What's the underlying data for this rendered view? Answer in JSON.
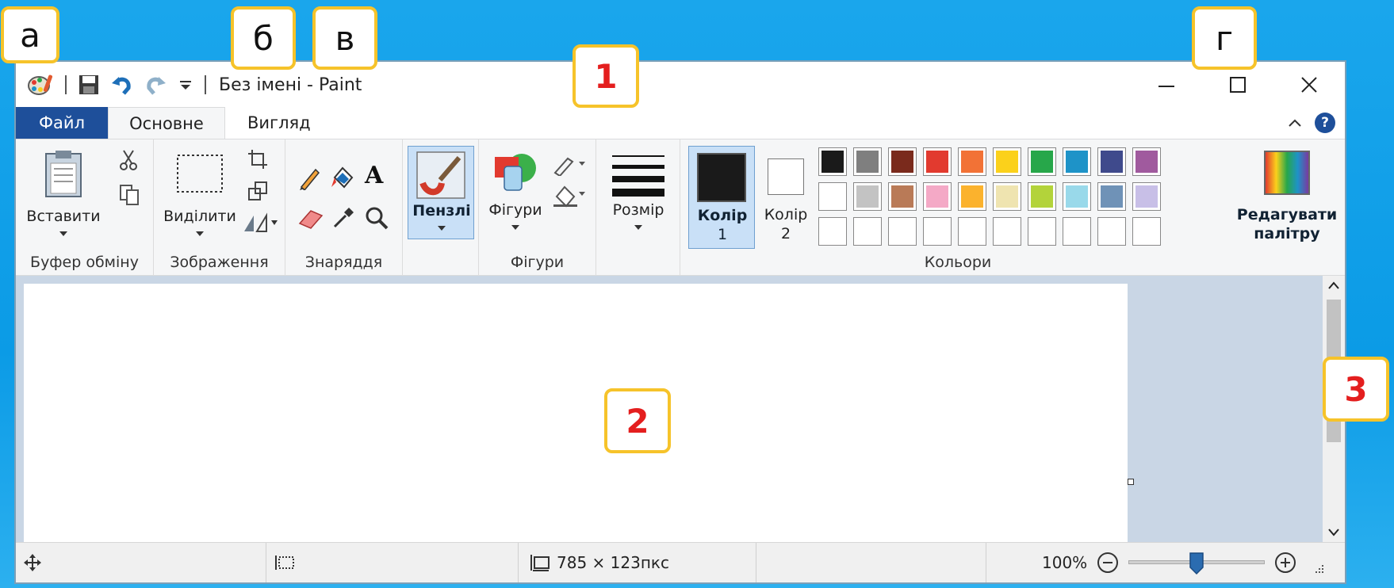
{
  "overlay_labels": {
    "a": "а",
    "b": "б",
    "v": "в",
    "g": "г",
    "n1": "1",
    "n2": "2",
    "n3": "3"
  },
  "window": {
    "title": "Без імені - Paint"
  },
  "tabs": {
    "file": "Файл",
    "home": "Основне",
    "view": "Вигляд"
  },
  "ribbon": {
    "clipboard": {
      "paste": "Вставити",
      "group": "Буфер обміну"
    },
    "image": {
      "select": "Виділити",
      "group": "Зображення"
    },
    "tools": {
      "group": "Знаряддя"
    },
    "brushes": {
      "label": "Пензлі"
    },
    "shapes": {
      "label": "Фігури",
      "group": "Фігури"
    },
    "size": {
      "label": "Розмір"
    },
    "colors": {
      "color1_line1": "Колір",
      "color1_line2": "1",
      "color2_line1": "Колір",
      "color2_line2": "2",
      "edit_line1": "Редагувати",
      "edit_line2": "палітру",
      "group": "Кольори",
      "row1": [
        "#1a1a1a",
        "#7f7f7f",
        "#7a2a1c",
        "#e23a2f",
        "#f27236",
        "#fbd11b",
        "#27a74a",
        "#1e93c8",
        "#3f4a8c",
        "#a05a9e"
      ],
      "row2": [
        "#ffffff",
        "#c3c3c3",
        "#b97a57",
        "#f4a9c6",
        "#fbb22d",
        "#efe4b0",
        "#b3d33a",
        "#99d9ea",
        "#6f92b7",
        "#c8bfe7"
      ]
    }
  },
  "status": {
    "size": "785 × 123пкс",
    "zoom": "100%"
  }
}
